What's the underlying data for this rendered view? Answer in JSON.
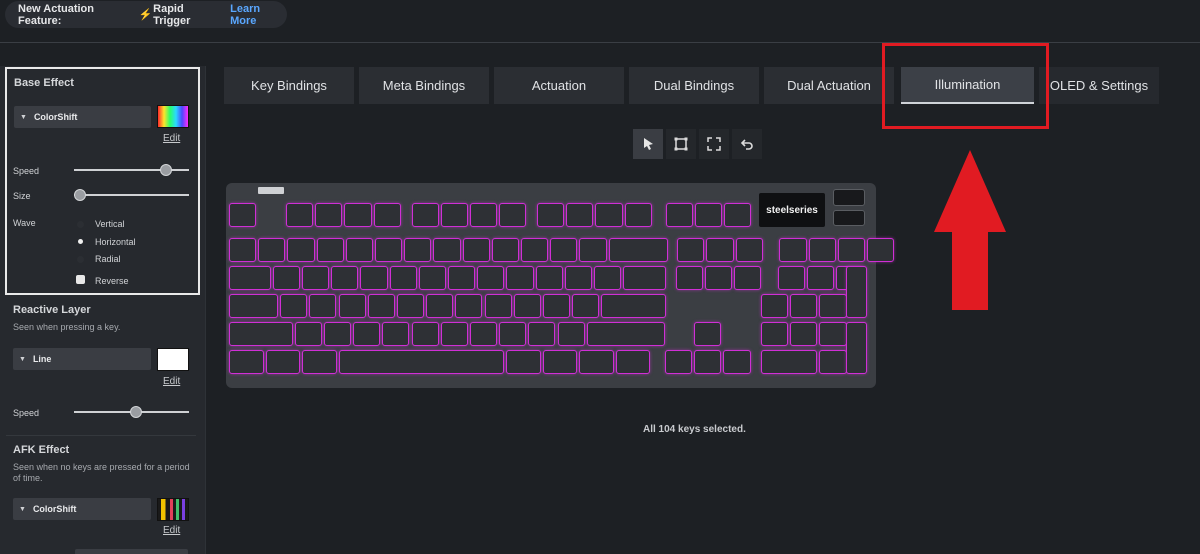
{
  "banner": {
    "prefix": "New Actuation Feature:",
    "bolt_icon": "⚡",
    "feature": "Rapid Trigger",
    "link": "Learn More"
  },
  "sidebar": {
    "base_effect": {
      "title": "Base Effect",
      "effect": "ColorShift",
      "edit": "Edit",
      "speed_label": "Speed",
      "speed_value": 0.9,
      "size_label": "Size",
      "size_value": 0.03,
      "wave_label": "Wave",
      "wave_options": [
        "Vertical",
        "Horizontal",
        "Radial"
      ],
      "wave_selected": "Horizontal",
      "reverse_label": "Reverse"
    },
    "reactive_layer": {
      "title": "Reactive Layer",
      "subtitle": "Seen when pressing a key.",
      "effect": "Line",
      "edit": "Edit",
      "speed_label": "Speed",
      "speed_value": 0.55
    },
    "afk_effect": {
      "title": "AFK Effect",
      "subtitle": "Seen when no keys are pressed for a period of time.",
      "effect": "ColorShift",
      "edit": "Edit"
    }
  },
  "tabs": [
    "Key Bindings",
    "Meta Bindings",
    "Actuation",
    "Dual Bindings",
    "Dual Actuation",
    "Illumination",
    "OLED & Settings"
  ],
  "active_tab": "Illumination",
  "tools": [
    "pointer-icon",
    "select-rect-icon",
    "fullscreen-icon",
    "undo-icon"
  ],
  "keyboard": {
    "brand": "steelseries",
    "key_color": "#d02fd6"
  },
  "status": "All 104 keys selected.",
  "colors": {
    "highlight": "#e11b22",
    "accent": "#5aa7ff",
    "bolt": "#f2b705"
  }
}
